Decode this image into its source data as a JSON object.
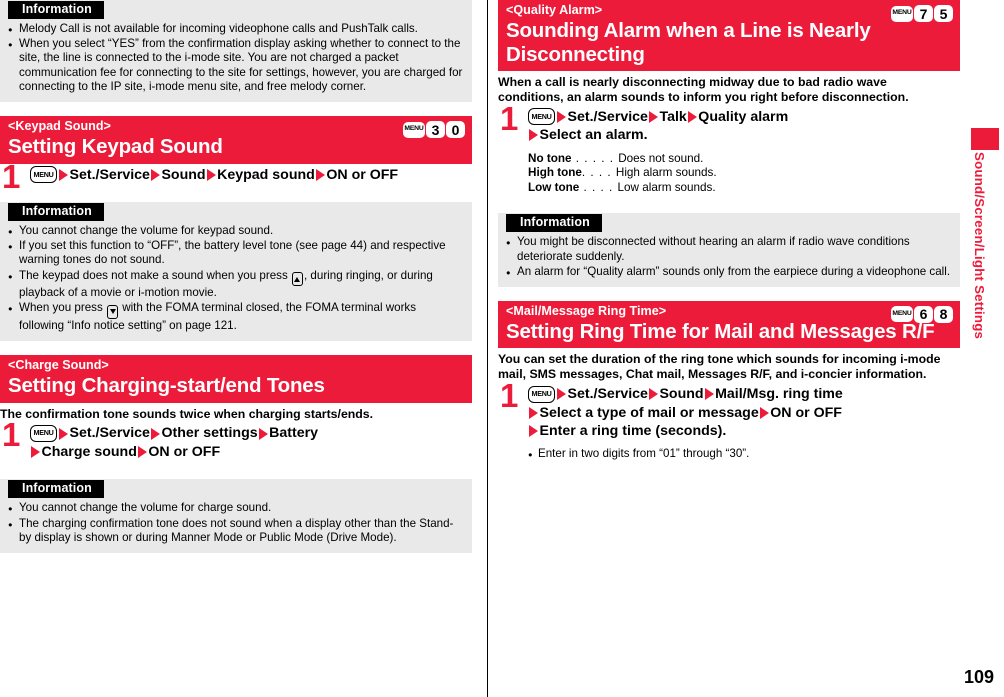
{
  "page": {
    "number": "109",
    "side_tab_label": "Sound/Screen/Light Settings"
  },
  "left_column": {
    "info_top": {
      "title": "Information",
      "items": [
        "Melody Call is not available for incoming videophone calls and PushTalk calls.",
        "When you select “YES” from the confirmation display asking whether to connect to the site, the line is connected to the i-mode site. You are not charged a packet communication fee for connecting to the site for settings, however, you are charged for connecting to the IP site, i-mode menu site, and free melody corner."
      ]
    },
    "keypad_section": {
      "subtitle": "<Keypad Sound>",
      "title": "Setting Keypad Sound",
      "keys": [
        "MENU",
        "3",
        "0"
      ],
      "step_number": "1",
      "step_lines": [
        {
          "menu_key": "MENU",
          "parts": [
            "Set./Service",
            "Sound",
            "Keypad sound",
            "ON or OFF"
          ]
        }
      ],
      "info": {
        "title": "Information",
        "items": [
          "You cannot change the volume for keypad sound.",
          "If you set this function to “OFF”, the battery level tone (see page 44) and respective warning tones do not sound.",
          "The keypad does not make a sound when you press ▲, during ringing, or during playback of a movie or i-motion movie.",
          "When you press ▼ with the FOMA terminal closed, the FOMA terminal works following “Info notice setting” on page 121."
        ]
      }
    },
    "charge_section": {
      "subtitle": "<Charge Sound>",
      "title": "Setting Charging-start/end Tones",
      "lead": "The confirmation tone sounds twice when charging starts/ends.",
      "step_number": "1",
      "step_line_1_parts": [
        "Set./Service",
        "Other settings",
        "Battery"
      ],
      "step_line_2_parts": [
        "Charge sound",
        "ON or OFF"
      ],
      "menu_key": "MENU",
      "info": {
        "title": "Information",
        "items": [
          "You cannot change the volume for charge sound.",
          "The charging confirmation tone does not sound when a display other than the Stand-by display is shown or during Manner Mode or Public Mode (Drive Mode)."
        ]
      }
    }
  },
  "right_column": {
    "quality_section": {
      "subtitle": "<Quality Alarm>",
      "title": "Sounding Alarm when a Line is Nearly Disconnecting",
      "keys": [
        "MENU",
        "7",
        "5"
      ],
      "lead": "When a call is nearly disconnecting midway due to bad radio wave conditions, an alarm sounds to inform you right before disconnection.",
      "step_number": "1",
      "menu_key": "MENU",
      "step_line_1_parts": [
        "Set./Service",
        "Talk",
        "Quality alarm"
      ],
      "step_line_2_parts": [
        "Select an alarm."
      ],
      "definitions": [
        {
          "term": "No tone",
          "dots": " . . . . . ",
          "desc": "Does not sound."
        },
        {
          "term": "High tone",
          "dots": ". . . . ",
          "desc": "High alarm sounds."
        },
        {
          "term": "Low tone",
          "dots": " . . . . ",
          "desc": "Low alarm sounds."
        }
      ],
      "info": {
        "title": "Information",
        "items": [
          "You might be disconnected without hearing an alarm if radio wave conditions deteriorate suddenly.",
          "An alarm for “Quality alarm” sounds only from the earpiece during a videophone call."
        ]
      }
    },
    "mail_section": {
      "subtitle": "<Mail/Message Ring Time>",
      "title": "Setting Ring Time for Mail and Messages R/F",
      "keys": [
        "MENU",
        "6",
        "8"
      ],
      "lead": "You can set the duration of the ring tone which sounds for incoming i-mode mail, SMS messages, Chat mail, Messages R/F, and i-concier information.",
      "step_number": "1",
      "menu_key": "MENU",
      "step_line_1_parts": [
        "Set./Service",
        "Sound",
        "Mail/Msg. ring time"
      ],
      "step_line_2_parts": [
        "Select a type of mail or message",
        "ON or OFF"
      ],
      "step_line_3_parts": [
        "Enter a ring time (seconds)."
      ],
      "subnote": "Enter in two digits from “01” through “30”."
    }
  },
  "colors": {
    "accent_red": "#ed1b3a",
    "info_bg": "#e9e9e9",
    "title_bar_black": "#000000"
  }
}
